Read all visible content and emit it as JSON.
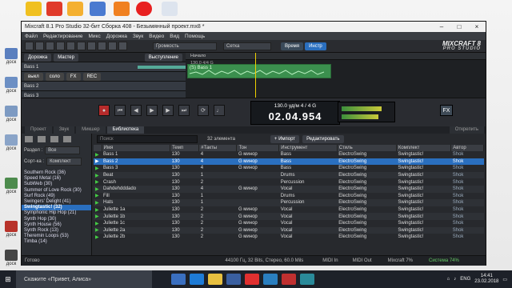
{
  "desktop": {
    "icons": [
      {
        "label": "доск",
        "color": "#5a7fbf"
      },
      {
        "label": "доск",
        "color": "#6c8fc4"
      },
      {
        "label": "доск",
        "color": "#7d9ac2"
      },
      {
        "label": "доск",
        "color": "#8aa4c8"
      },
      {
        "label": "доск",
        "color": "#4d8b4d"
      },
      {
        "label": "доск",
        "color": "#b8322a"
      },
      {
        "label": "доск",
        "color": "#444444"
      }
    ]
  },
  "window": {
    "title": "Mixcraft 8.1 Pro Studio 32-бит Сборка 408 - Безымянный проект.mx8 *",
    "menu": [
      "Файл",
      "Редактирование",
      "Микс",
      "Дорожка",
      "Звук",
      "Видео",
      "Вид",
      "Помощь"
    ],
    "toolbar": {
      "dd1": "Громкость",
      "dd2": "Сетка",
      "time_btn": "Время",
      "instr_btn": "Инстр"
    },
    "logo": {
      "main": "MIXCRAFT 8",
      "sub": "PRO STUDIO"
    },
    "tracks_header": {
      "tab1": "Дорожка",
      "tab2": "Мастер",
      "out": "Выступление"
    },
    "ruler": {
      "marker": "Начало",
      "tempo": "130.0 4/4 G"
    },
    "track_names": [
      "Bass 1",
      "Bass 2",
      "Bass 3"
    ],
    "track_controls": [
      "выкл",
      "соло",
      "FX",
      "REC"
    ],
    "clip_label": "(S) Bass 1",
    "transport": {
      "tempo_line": "130.0 уд/м  4 / 4   G",
      "time": "02.04.954",
      "fx": "FX"
    },
    "tabs": [
      "Проект",
      "Звук",
      "Микшер",
      "Библиотека"
    ],
    "active_tab": "Библиотека",
    "right_tab": "Открепить",
    "library": {
      "section_label": "Раздел :",
      "section_value": "Все",
      "sort_label": "Сорт-ка :",
      "sort_value": "Комплект",
      "search_placeholder": "Поиск",
      "count": "32 элемента",
      "import_btn": "+ Импорт",
      "edit_btn": "Редактировать",
      "genres": [
        "Southern Rock (36)",
        "Speed Metal (16)",
        "SubWeb (30)",
        "Summer of Love Rock (30)",
        "Surf Rock (49)",
        "Swingers' Delight (41)",
        "Swingtastic! (32)",
        "Symphonic Hip Hop (21)",
        "Synth Hop (30)",
        "Synth House (56)",
        "Synth Rock (13)",
        "Theremin Loops (53)",
        "Timba (14)"
      ],
      "selected_genre": "Swingtastic! (32)",
      "columns": [
        "",
        "Имя",
        "Темп",
        "#Такты",
        "Тон",
        "Инструмент",
        "Стиль",
        "Комплект",
        "Автор"
      ],
      "rows": [
        [
          "Bass 1",
          "130",
          "4",
          "G минор",
          "Bass",
          "ElectroSwing",
          "Swingtastic!",
          "Shok"
        ],
        [
          "Bass 2",
          "130",
          "4",
          "G минор",
          "Bass",
          "ElectroSwing",
          "Swingtastic!",
          "Shok"
        ],
        [
          "Bass 3",
          "130",
          "4",
          "G минор",
          "Bass",
          "ElectroSwing",
          "Swingtastic!",
          "Shok"
        ],
        [
          "Beat",
          "130",
          "1",
          "",
          "Drums",
          "ElectroSwing",
          "Swingtastic!",
          "Shok"
        ],
        [
          "Crash",
          "130",
          "2",
          "",
          "Percussion",
          "ElectroSwing",
          "Swingtastic!",
          "Shok"
        ],
        [
          "Dahdehdddado",
          "130",
          "4",
          "G минор",
          "Vocal",
          "ElectroSwing",
          "Swingtastic!",
          "Shok"
        ],
        [
          "Fill",
          "130",
          "1",
          "",
          "Drums",
          "ElectroSwing",
          "Swingtastic!",
          "Shok"
        ],
        [
          "Hats",
          "130",
          "1",
          "",
          "Percussion",
          "ElectroSwing",
          "Swingtastic!",
          "Shok"
        ],
        [
          "Juliette 1a",
          "130",
          "2",
          "G минор",
          "Vocal",
          "ElectroSwing",
          "Swingtastic!",
          "Shok"
        ],
        [
          "Juliette 1b",
          "130",
          "2",
          "G минор",
          "Vocal",
          "ElectroSwing",
          "Swingtastic!",
          "Shok"
        ],
        [
          "Juliette 1c",
          "130",
          "2",
          "G минор",
          "Vocal",
          "ElectroSwing",
          "Swingtastic!",
          "Shok"
        ],
        [
          "Juliette 2a",
          "130",
          "2",
          "G минор",
          "Vocal",
          "ElectroSwing",
          "Swingtastic!",
          "Shok"
        ],
        [
          "Juliette 2b",
          "130",
          "2",
          "G минор",
          "Vocal",
          "ElectroSwing",
          "Swingtastic!",
          "Shok"
        ]
      ],
      "selected_row": 1
    },
    "status": {
      "left": "Готово",
      "format": "44100 Гц, 32 Bits, Стерео, 60.0 Mils",
      "midi_in": "MIDI In",
      "midi_out": "MIDI Out",
      "cpu": "Mixcraft 7%",
      "system": "Система 74%"
    }
  },
  "taskbar": {
    "search": "Скажите «Привет, Алиса»",
    "lang": "ENG",
    "time": "14:41",
    "date": "23.02.2018"
  }
}
